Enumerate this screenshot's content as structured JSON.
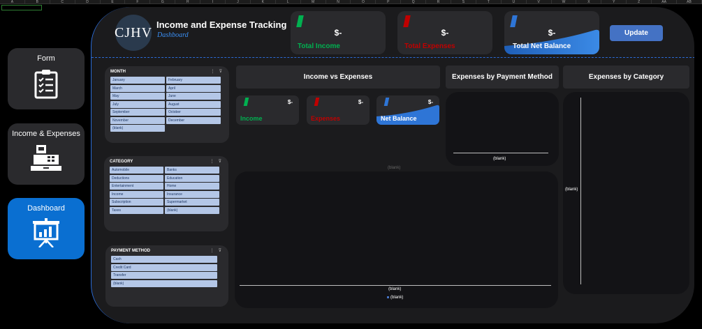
{
  "spreadsheet": {
    "columns": [
      "A",
      "B",
      "C",
      "D",
      "E",
      "F",
      "G",
      "H",
      "I",
      "J",
      "K",
      "L",
      "M",
      "N",
      "O",
      "P",
      "Q",
      "R",
      "S",
      "T",
      "U",
      "V",
      "W",
      "X",
      "Y",
      "Z",
      "AA",
      "AB"
    ]
  },
  "nav": {
    "form_label": "Form",
    "income_expenses_label": "Income & Expenses",
    "dashboard_label": "Dashboard"
  },
  "header": {
    "logo_text": "CJHV",
    "title": "Income and Expense Tracking",
    "subtitle": "Dashboard",
    "update_label": "Update"
  },
  "kpis": {
    "total_income": {
      "value": "$-",
      "label": "Total Income",
      "color": "#00b050"
    },
    "total_expenses": {
      "value": "$-",
      "label": "Total Expenses",
      "color": "#c00000"
    },
    "total_net": {
      "value": "$-",
      "label": "Total Net Balance",
      "color": "#2e75d6"
    }
  },
  "slicers": {
    "month": {
      "title": "MONTH",
      "items": [
        "January",
        "February",
        "March",
        "April",
        "May",
        "June",
        "July",
        "August",
        "September",
        "October",
        "November",
        "December",
        "(blank)"
      ]
    },
    "category": {
      "title": "CATEGORY",
      "items": [
        "Automobile",
        "Banks",
        "Deductions",
        "Education",
        "Entertainment",
        "Home",
        "Income",
        "Insurance",
        "Subscription",
        "Supermarket",
        "Taxes",
        "(blank)"
      ]
    },
    "payment": {
      "title": "PAYMENT METHOD",
      "items": [
        "Cash",
        "Credit Card",
        "Transfer",
        "(blank)"
      ]
    },
    "icons": {
      "multi_select": "⋮",
      "clear_filter": "⊽"
    }
  },
  "charts": {
    "income_vs_expenses": {
      "title": "Income vs Expenses",
      "cards": {
        "income": {
          "value": "$-",
          "label": "Income"
        },
        "expenses": {
          "value": "$-",
          "label": "Expenses"
        },
        "net": {
          "value": "$-",
          "label": "Net Balance"
        }
      },
      "top_label": "(blank)",
      "x_label": "(blank)",
      "legend": "(blank)"
    },
    "by_payment": {
      "title": "Expenses by Payment Method",
      "x_label": "(blank)"
    },
    "by_category": {
      "title": "Expenses by Category",
      "y_label": "(blank)"
    }
  },
  "chart_data": [
    {
      "type": "bar",
      "title": "Income vs Expenses",
      "categories": [
        "(blank)"
      ],
      "series": [
        {
          "name": "(blank)",
          "values": []
        }
      ]
    },
    {
      "type": "bar",
      "title": "Expenses by Payment Method",
      "categories": [
        "(blank)"
      ],
      "values": []
    },
    {
      "type": "bar",
      "title": "Expenses by Category",
      "categories": [
        "(blank)"
      ],
      "values": []
    }
  ]
}
